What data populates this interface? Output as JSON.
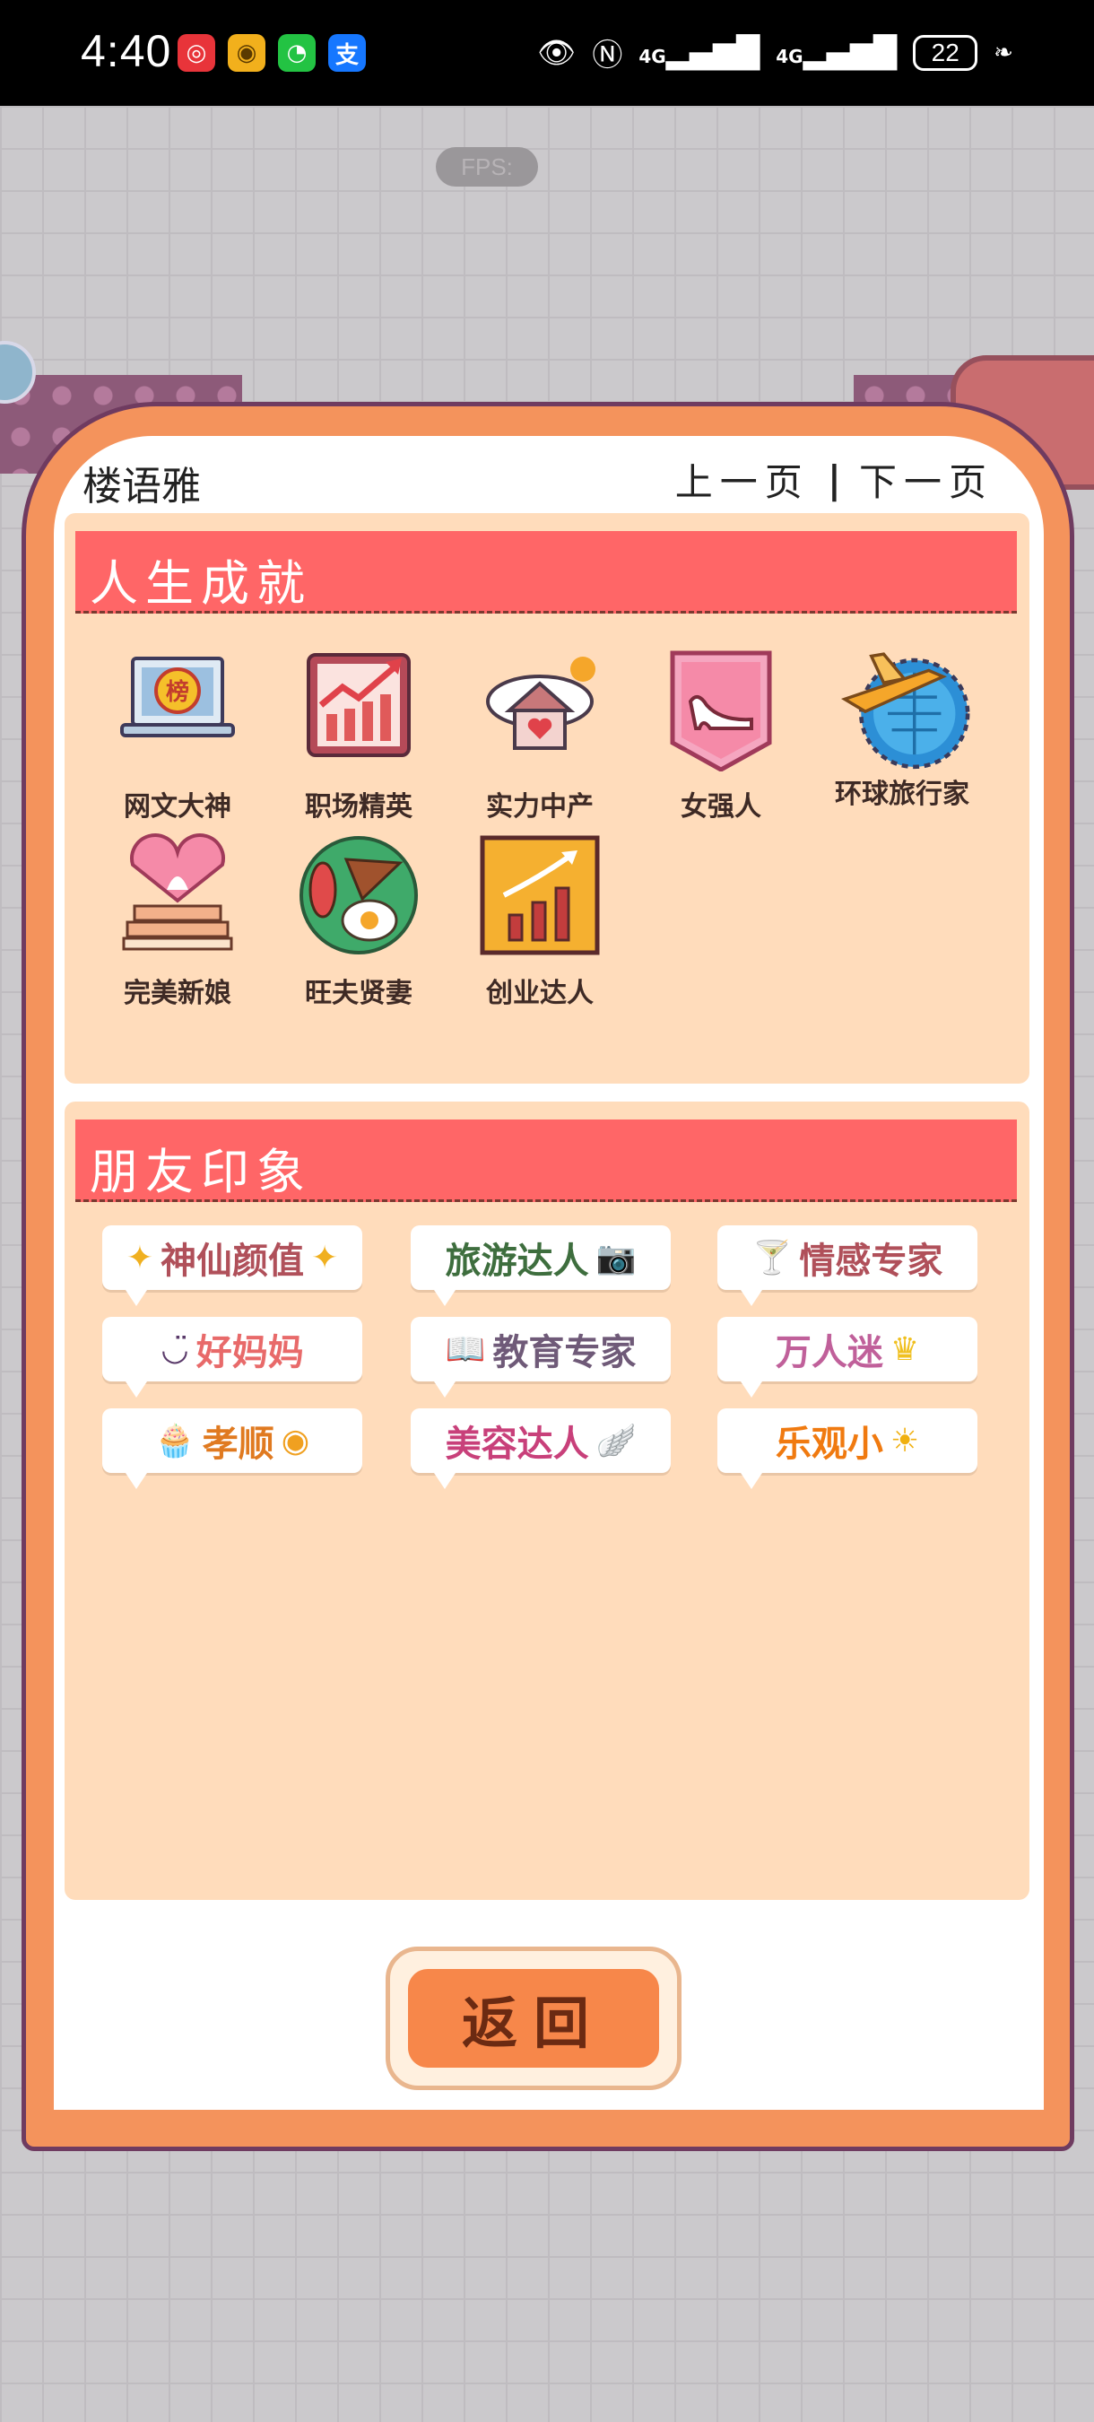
{
  "status_bar": {
    "time": "4:40",
    "network_1": "4G",
    "network_2": "4G",
    "battery": "22"
  },
  "background": {
    "fps_label": "FPS:"
  },
  "dialog": {
    "player_name": "楼语雅",
    "prev_page": "上一页",
    "next_page": "下一页",
    "separator": "|",
    "return_label": "返回"
  },
  "achievements": {
    "title": "人生成就",
    "items": [
      {
        "label": "网文大神",
        "icon": "laptop-rank-icon"
      },
      {
        "label": "职场精英",
        "icon": "rising-chart-icon"
      },
      {
        "label": "实力中产",
        "icon": "house-heart-icon"
      },
      {
        "label": "女强人",
        "icon": "high-heel-icon"
      },
      {
        "label": "环球旅行家",
        "icon": "globe-plane-icon"
      },
      {
        "label": "完美新娘",
        "icon": "wedding-cake-icon"
      },
      {
        "label": "旺夫贤妻",
        "icon": "breakfast-plate-icon"
      },
      {
        "label": "创业达人",
        "icon": "growth-bars-icon"
      }
    ],
    "icon_badge": "榜"
  },
  "impressions": {
    "title": "朋友印象",
    "tags": [
      {
        "label": "神仙颜值",
        "color": "#b0505a",
        "icon": "sparkle-icon"
      },
      {
        "label": "旅游达人",
        "color": "#3e6e3e",
        "icon": "camera-icon"
      },
      {
        "label": "情感专家",
        "color": "#b0505a",
        "icon": "cocktail-icon"
      },
      {
        "label": "好妈妈",
        "color": "#e86a6a",
        "icon": "smile-icon"
      },
      {
        "label": "教育专家",
        "color": "#6f5a78",
        "icon": "book-icon"
      },
      {
        "label": "万人迷",
        "color": "#c0609a",
        "icon": "crown-icon"
      },
      {
        "label": "孝顺",
        "color": "#e07a20",
        "icon": "cupcake-icon"
      },
      {
        "label": "美容达人",
        "color": "#c8407a",
        "icon": "wing-icon"
      },
      {
        "label": "乐观小",
        "color": "#f07a10",
        "icon": "sun-icon"
      }
    ]
  }
}
